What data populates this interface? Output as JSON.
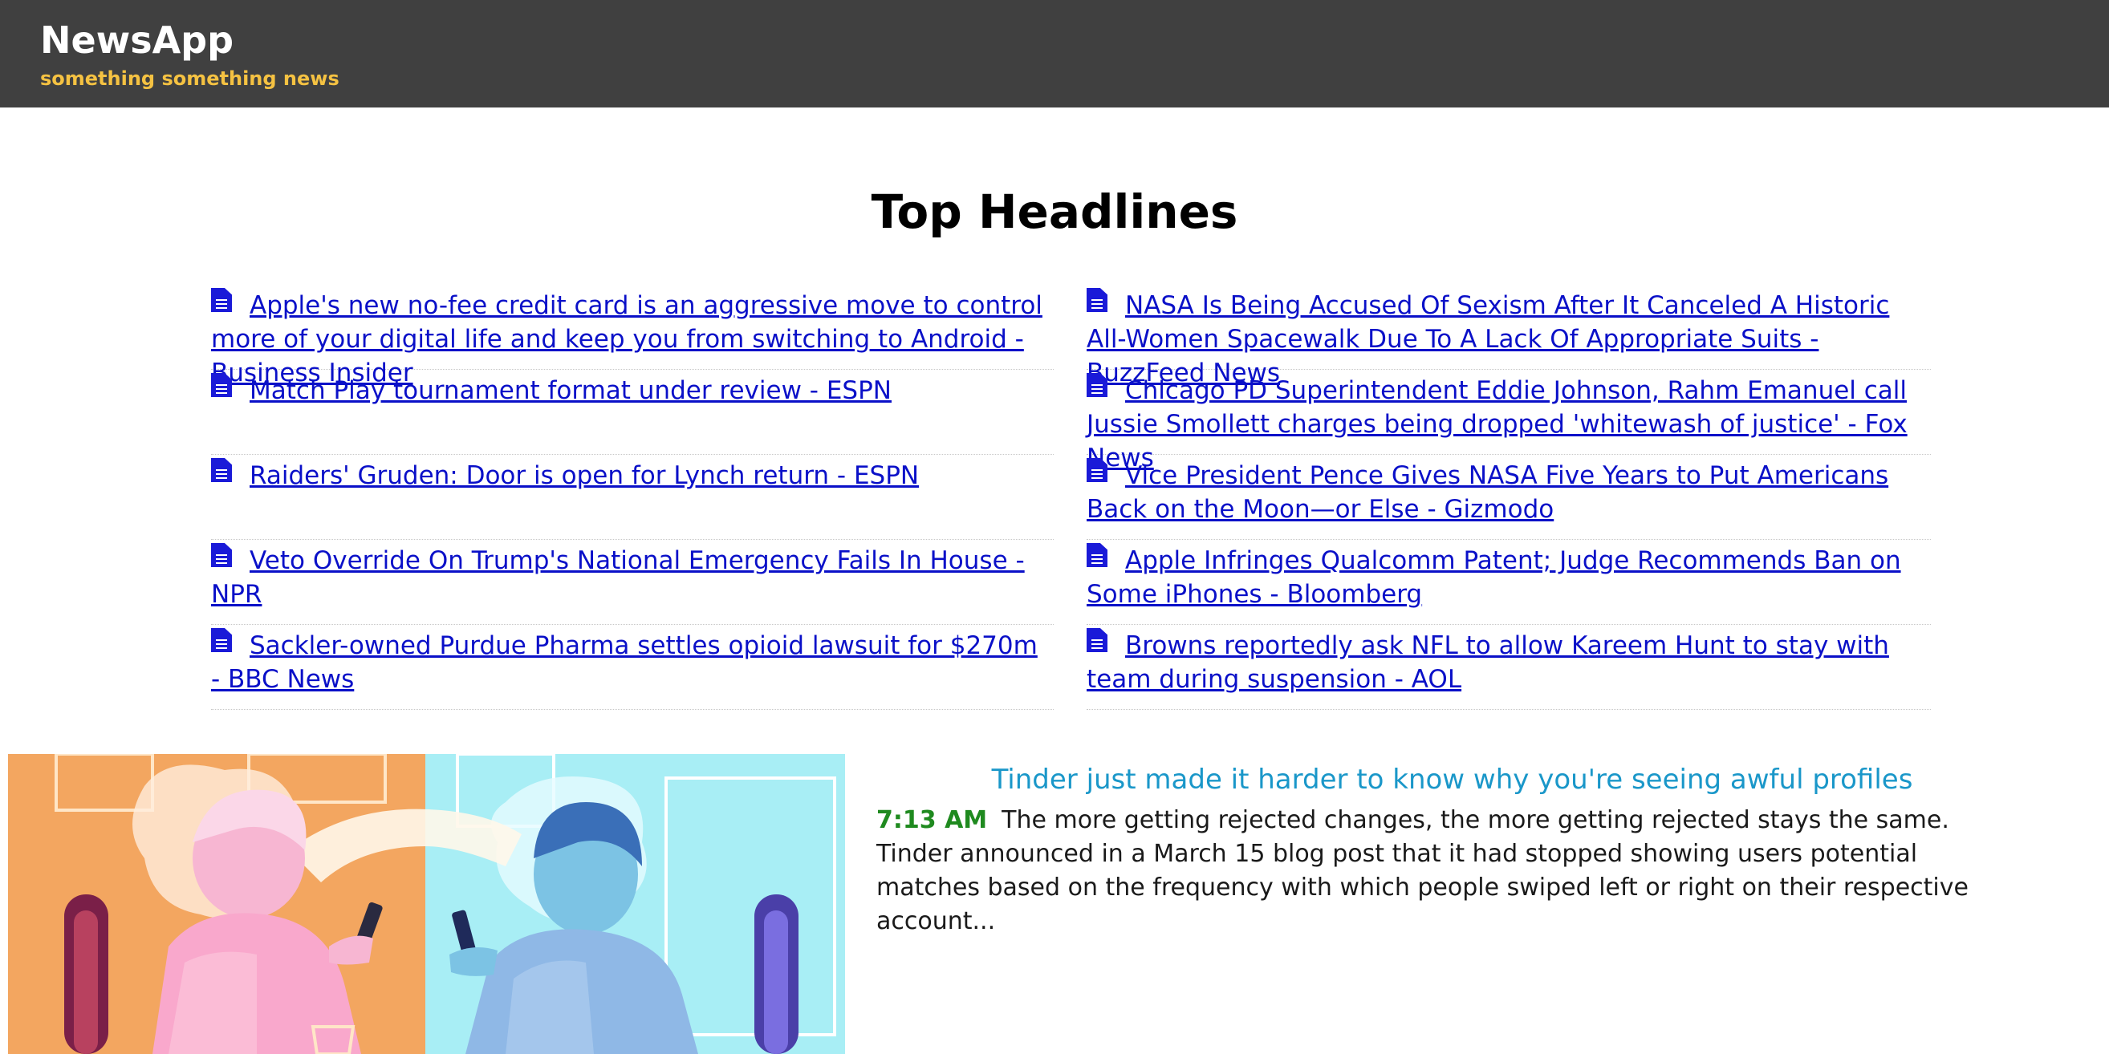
{
  "app": {
    "brand": "NewsApp",
    "tagline": "something something news"
  },
  "headlines": {
    "title": "Top Headlines",
    "left": [
      "Apple's new no-fee credit card is an aggressive move to control more of your digital life and keep you from switching to Android - Business Insider",
      "Match Play tournament format under review - ESPN",
      "Raiders' Gruden: Door is open for Lynch return - ESPN",
      "Veto Override On Trump's National Emergency Fails In House - NPR",
      "Sackler-owned Purdue Pharma settles opioid lawsuit for $270m - BBC News"
    ],
    "right": [
      "NASA Is Being Accused Of Sexism After It Canceled A Historic All-Women Spacewalk Due To A Lack Of Appropriate Suits - BuzzFeed News",
      "Chicago PD Superintendent Eddie Johnson, Rahm Emanuel call Jussie Smollett charges being dropped 'whitewash of justice' - Fox News",
      "Vice President Pence Gives NASA Five Years to Put Americans Back on the Moon—or Else - Gizmodo",
      "Apple Infringes Qualcomm Patent; Judge Recommends Ban on Some iPhones - Bloomberg",
      "Browns reportedly ask NFL to allow Kareem Hunt to stay with team during suspension - AOL"
    ]
  },
  "feature": {
    "title": "Tinder just made it harder to know why you're seeing awful profiles",
    "time": "7:13 AM",
    "summary": "The more getting rejected changes, the more getting rejected stays the same. Tinder announced in a March 15 blog post that it had stopped showing users potential matches based on the frequency with which people swiped left or right on their respective account..."
  },
  "colors": {
    "navbar": "#404040",
    "tagline": "#f5c242",
    "link": "#0a10c8",
    "feature_title": "#1a97c9",
    "time": "#1f8a1f"
  }
}
